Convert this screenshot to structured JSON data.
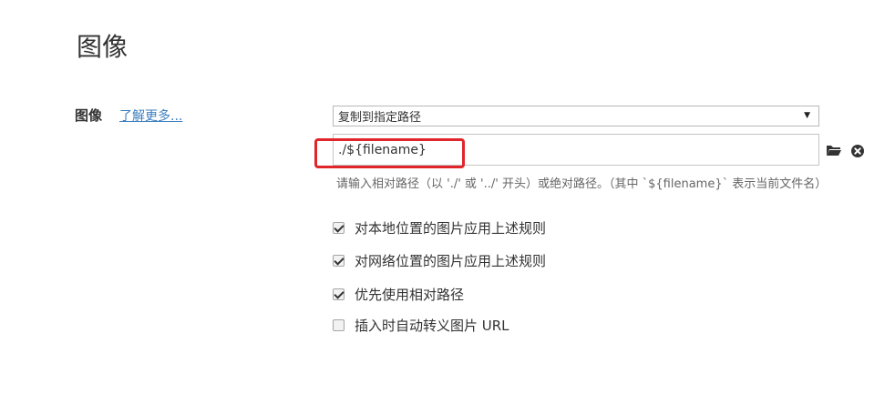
{
  "page": {
    "title": "图像"
  },
  "image_section": {
    "label": "图像",
    "learn_more": "了解更多..."
  },
  "action_select": {
    "selected": "复制到指定路径"
  },
  "path_field": {
    "value": "./${filename}"
  },
  "hint": "请输入相对路径（以 './' 或 '../' 开头）或绝对路径。（其中 `${filename}` 表示当前文件名）",
  "icons": {
    "folder": "folder-icon",
    "clear": "clear-circle-icon",
    "dropdown": "triangle-down-icon"
  },
  "options": [
    {
      "label": "对本地位置的图片应用上述规则",
      "checked": true
    },
    {
      "label": "对网络位置的图片应用上述规则",
      "checked": true
    },
    {
      "label": "优先使用相对路径",
      "checked": true
    },
    {
      "label": "插入时自动转义图片 URL",
      "checked": false
    }
  ],
  "colors": {
    "link": "#3d7fbf",
    "highlight": "#e0252b"
  }
}
